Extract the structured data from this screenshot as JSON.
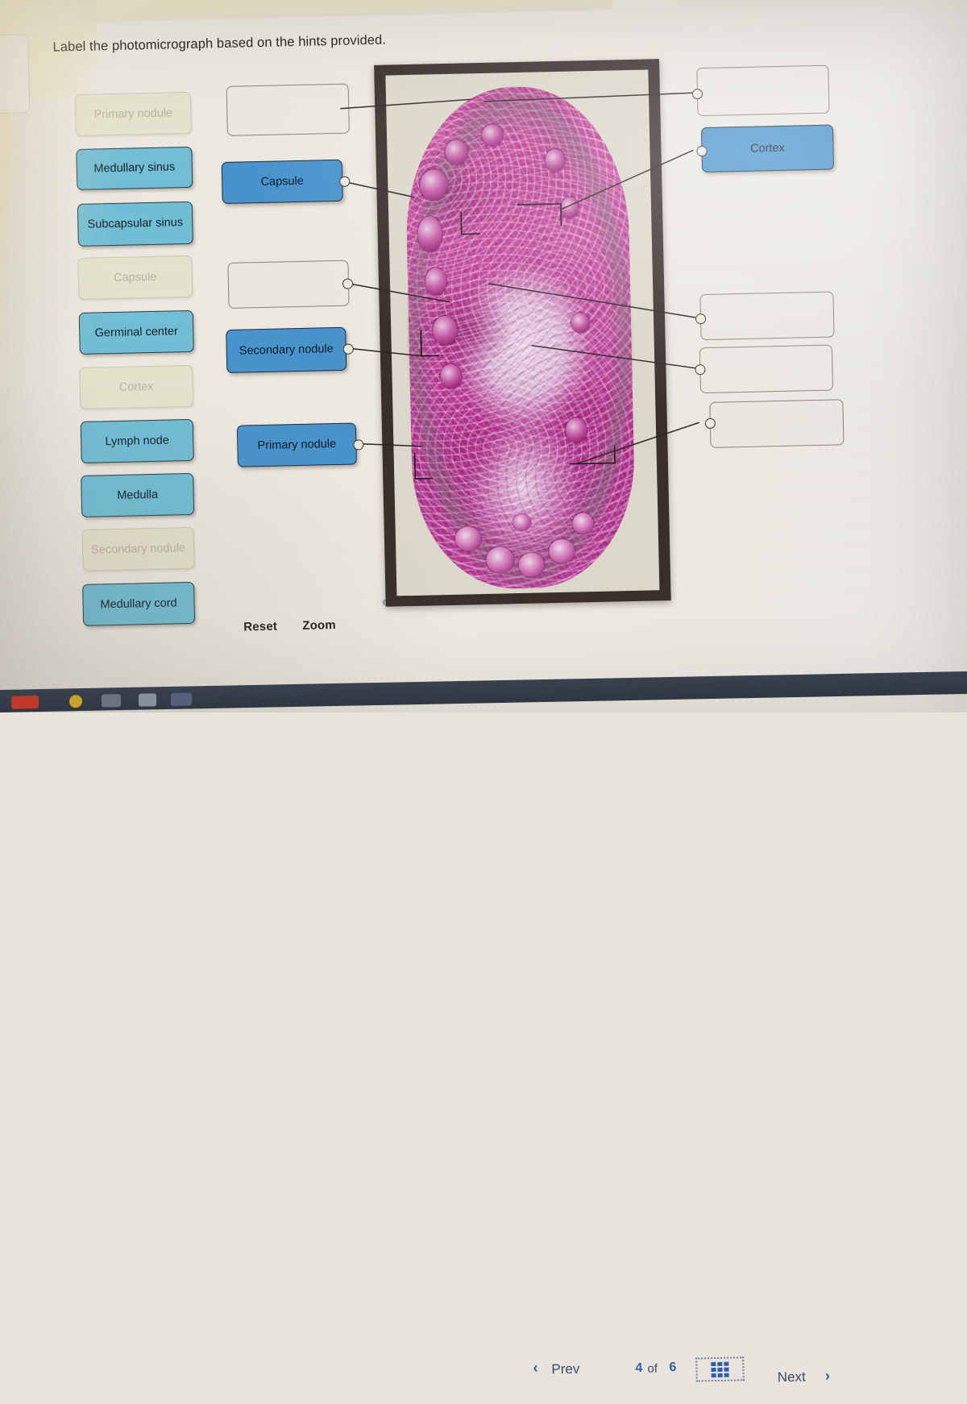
{
  "question_number": "4",
  "prompt": "Label the photomicrograph based on the hints provided.",
  "label_bank": [
    {
      "text": "Primary nodule",
      "state": "used"
    },
    {
      "text": "Medullary sinus",
      "state": "available"
    },
    {
      "text": "Subcapsular sinus",
      "state": "available"
    },
    {
      "text": "Capsule",
      "state": "used"
    },
    {
      "text": "Germinal center",
      "state": "available"
    },
    {
      "text": "Cortex",
      "state": "used"
    },
    {
      "text": "Lymph node",
      "state": "available"
    },
    {
      "text": "Medulla",
      "state": "available"
    },
    {
      "text": "Secondary nodule",
      "state": "used"
    },
    {
      "text": "Medullary cord",
      "state": "available"
    }
  ],
  "answer_slots": [
    {
      "id": "left-1",
      "text": "",
      "filled": false
    },
    {
      "id": "left-2",
      "text": "Capsule",
      "filled": true
    },
    {
      "id": "left-3",
      "text": "",
      "filled": false
    },
    {
      "id": "left-4",
      "text": "Secondary nodule",
      "filled": true
    },
    {
      "id": "left-5",
      "text": "Primary nodule",
      "filled": true
    },
    {
      "id": "right-1",
      "text": "",
      "filled": false
    },
    {
      "id": "right-2",
      "text": "Cortex",
      "filled": true
    },
    {
      "id": "right-3",
      "text": "",
      "filled": false
    },
    {
      "id": "right-4",
      "text": "",
      "filled": false
    },
    {
      "id": "right-5",
      "text": "",
      "filled": false
    }
  ],
  "image": {
    "credit": "©McGraw-Hill Education/Greg Reeder",
    "alt": "lymph node histology photomicrograph"
  },
  "tools": {
    "reset_label": "Reset",
    "zoom_label": "Zoom"
  },
  "navigation": {
    "prev_label": "Prev",
    "next_label": "Next",
    "prev_chevron": "‹",
    "next_chevron": "›",
    "current_page": "4",
    "of_label": "of",
    "total_pages": "6",
    "grid_icon": "grid-view-icon"
  },
  "colors": {
    "chip_available": "#73c0d6",
    "chip_placed": "#4a95cf",
    "chip_used": "#e7e4ce",
    "nav_accent": "#2f5fa8",
    "page_bg": "#efece4"
  }
}
